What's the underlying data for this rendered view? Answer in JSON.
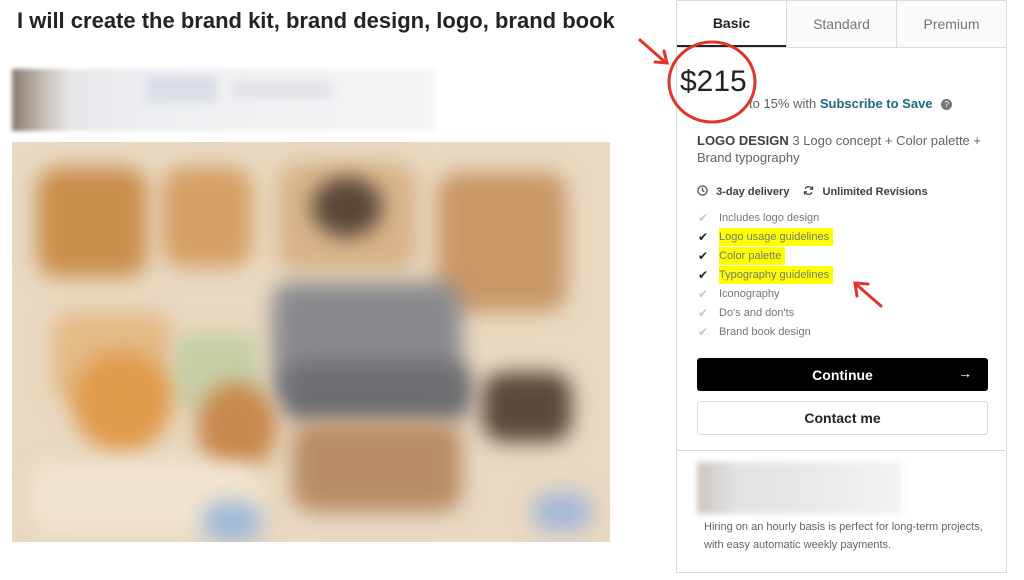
{
  "gig": {
    "title": "I will create the brand kit, brand design, logo, brand book"
  },
  "tabs": [
    "Basic",
    "Standard",
    "Premium"
  ],
  "package": {
    "price": "$215",
    "save_prefix": "to 15% with",
    "save_link": "Subscribe to Save",
    "help_icon": "?",
    "name": "LOGO DESIGN",
    "description": "3 Logo concept + Color palette + Brand typography",
    "delivery": "3-day delivery",
    "revisions": "Unlimited Revisions",
    "features": [
      {
        "label": "Includes logo design",
        "included": false
      },
      {
        "label": "Logo usage guidelines",
        "included": true
      },
      {
        "label": "Color palette",
        "included": true
      },
      {
        "label": "Typography guidelines",
        "included": true
      },
      {
        "label": "Iconography",
        "included": false
      },
      {
        "label": "Do's and don'ts",
        "included": false
      },
      {
        "label": "Brand book design",
        "included": false
      }
    ],
    "continue_label": "Continue",
    "continue_arrow": "→",
    "contact_label": "Contact me"
  },
  "hourly": {
    "text": "Hiring on an hourly basis is perfect for long-term projects, with easy automatic weekly payments."
  },
  "colors": {
    "accent_link": "#1d6a81",
    "highlight": "#ffff00",
    "annotation": "#e0352b",
    "button": "#000000"
  },
  "icons": {
    "clock": "clock-icon",
    "revisions": "refresh-icon",
    "check": "check-icon",
    "arrow": "arrow-right-icon"
  }
}
